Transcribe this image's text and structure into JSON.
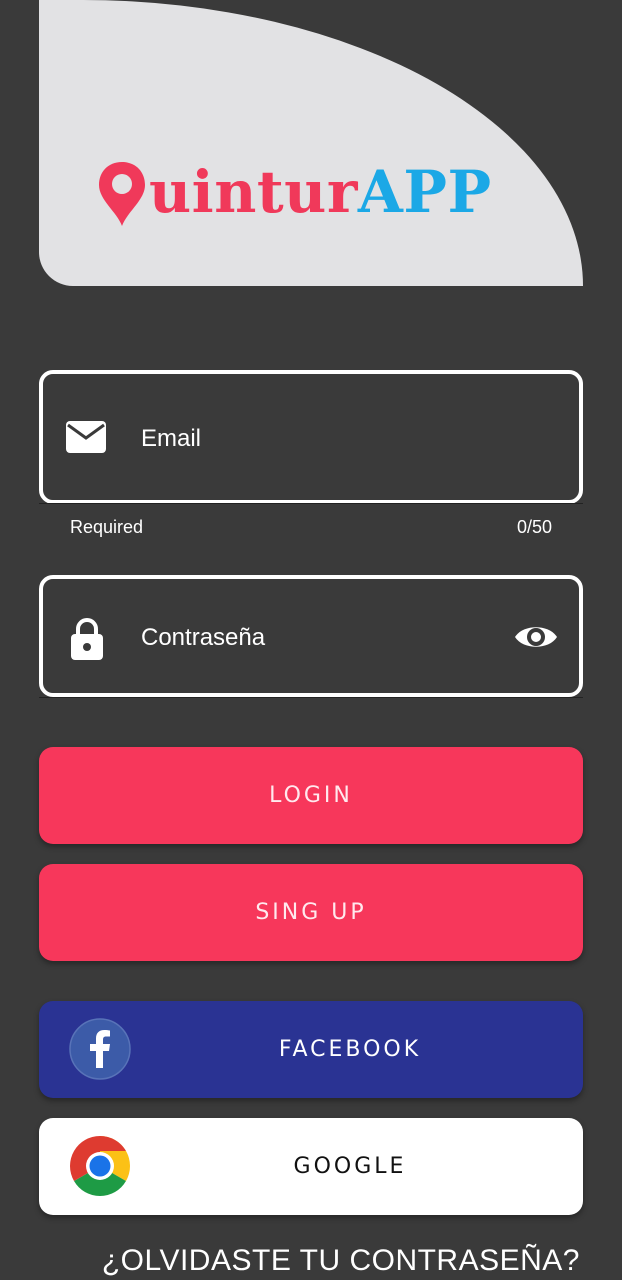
{
  "logo": {
    "part1": "uintur",
    "part2": "APP"
  },
  "email_field": {
    "placeholder": "Email",
    "helper_left": "Required",
    "helper_right": "0/50"
  },
  "password_field": {
    "placeholder": "Contraseña"
  },
  "buttons": {
    "login": "LOGIN",
    "signup": "SING UP",
    "facebook": "FACEBOOK",
    "google": "GOOGLE"
  },
  "forgot_password": "¿OLVIDASTE TU CONTRASEÑA?",
  "colors": {
    "background": "#3a3a3a",
    "header_panel": "#e2e2e4",
    "brand_red": "#f7375b",
    "brand_blue": "#1ba8e6",
    "facebook_blue": "#2a3393"
  },
  "icons": {
    "email": "mail-icon",
    "password": "lock-icon",
    "visibility": "eye-icon",
    "facebook": "facebook-icon",
    "google": "chrome-icon",
    "logo_pin": "map-pin-icon"
  }
}
